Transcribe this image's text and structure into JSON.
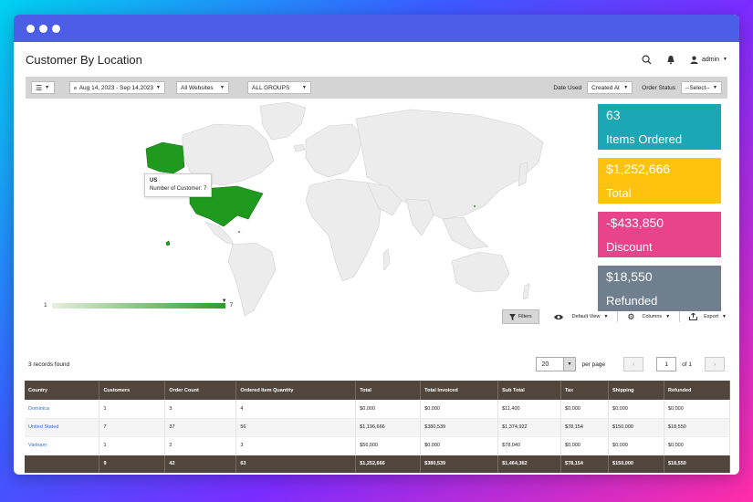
{
  "page": {
    "title": "Customer By Location"
  },
  "user": {
    "name": "admin"
  },
  "toolbar": {
    "date_range": "Aug 14, 2023 - Sep 14,2023",
    "website": "All Websites",
    "group": "ALL GROUPS",
    "date_used_label": "Date Used",
    "date_used_value": "Created At",
    "order_status_label": "Order Status",
    "order_status_value": "--Select--"
  },
  "map": {
    "tooltip_country": "US",
    "tooltip_text": "Number of Customer: 7",
    "legend_min": "1",
    "legend_max": "7",
    "highlight_color": "#1f9a1f"
  },
  "cards": [
    {
      "value": "63",
      "label": "Items Ordered",
      "color": "#1ba7b6"
    },
    {
      "value": "$1,252,666",
      "label": "Total",
      "color": "#ffc20e"
    },
    {
      "value": "-$433,850",
      "label": "Discount",
      "color": "#e8438b"
    },
    {
      "value": "$18,550",
      "label": "Refunded",
      "color": "#6f7f8d"
    }
  ],
  "actions": {
    "filters": "Filters",
    "view": "Default View",
    "columns": "Columns",
    "export": "Export"
  },
  "records": {
    "found": "3 records found",
    "per_page_value": "20",
    "per_page_label": "per page",
    "page": "1",
    "of": "of 1"
  },
  "table": {
    "headers": [
      "Country",
      "Customers",
      "Order Count",
      "Ordered Item Quantity",
      "Total",
      "Total Invoiced",
      "Sub Total",
      "Tax",
      "Shipping",
      "Refunded"
    ],
    "rows": [
      [
        "Dominica",
        "1",
        "3",
        "4",
        "$0,000",
        "$0,000",
        "$11,400",
        "$0,000",
        "$0,000",
        "$0,000"
      ],
      [
        "United Stated",
        "7",
        "37",
        "56",
        "$1,196,666",
        "$380,539",
        "$1,374,922",
        "$78,154",
        "$150,000",
        "$18,550"
      ],
      [
        "Vietnam",
        "1",
        "2",
        "3",
        "$56,000",
        "$0,000",
        "$78,040",
        "$0,000",
        "$0,000",
        "$0,000"
      ]
    ],
    "totals": [
      "",
      "9",
      "42",
      "63",
      "$1,252,666",
      "$380,539",
      "$1,464,362",
      "$78,154",
      "$150,000",
      "$18,550"
    ]
  }
}
